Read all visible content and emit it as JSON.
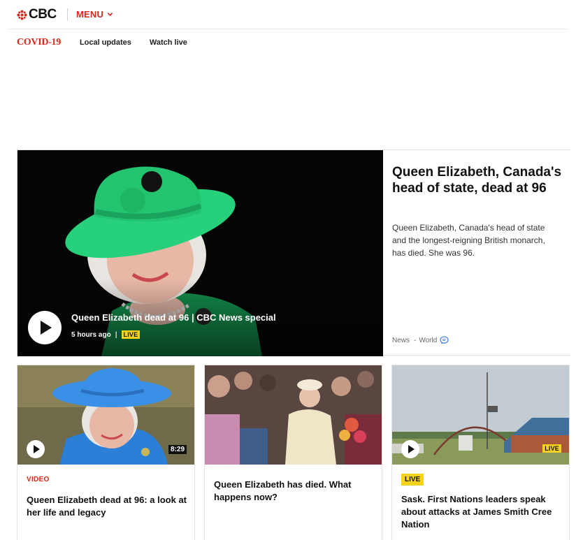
{
  "header": {
    "brand": "CBC",
    "menu_label": "MENU",
    "brand_color": "#d8281c"
  },
  "subnav": {
    "section": "COVID-19",
    "links": [
      "Local updates",
      "Watch live"
    ]
  },
  "hero": {
    "video_title": "Queen Elizabeth dead at 96 | CBC News special",
    "time": "5 hours ago",
    "live_label": "LIVE",
    "headline": "Queen Elizabeth, Canada's head of state, dead at 96",
    "dek": "Queen Elizabeth, Canada's head of state and the longest-reigning British monarch, has died. She was 96.",
    "tags": [
      "News",
      "World"
    ]
  },
  "cards": [
    {
      "eyebrow": "VIDEO",
      "duration": "8:29",
      "title": "Queen Elizabeth dead at 96: a look at her life and legacy"
    },
    {
      "title": "Queen Elizabeth has died. What happens now?"
    },
    {
      "badge": "LIVE",
      "eyebrow": "LIVE",
      "title": "Sask. First Nations leaders speak about attacks at James Smith Cree Nation"
    }
  ],
  "colors": {
    "accent": "#d8281c",
    "live": "#f6d21a"
  }
}
